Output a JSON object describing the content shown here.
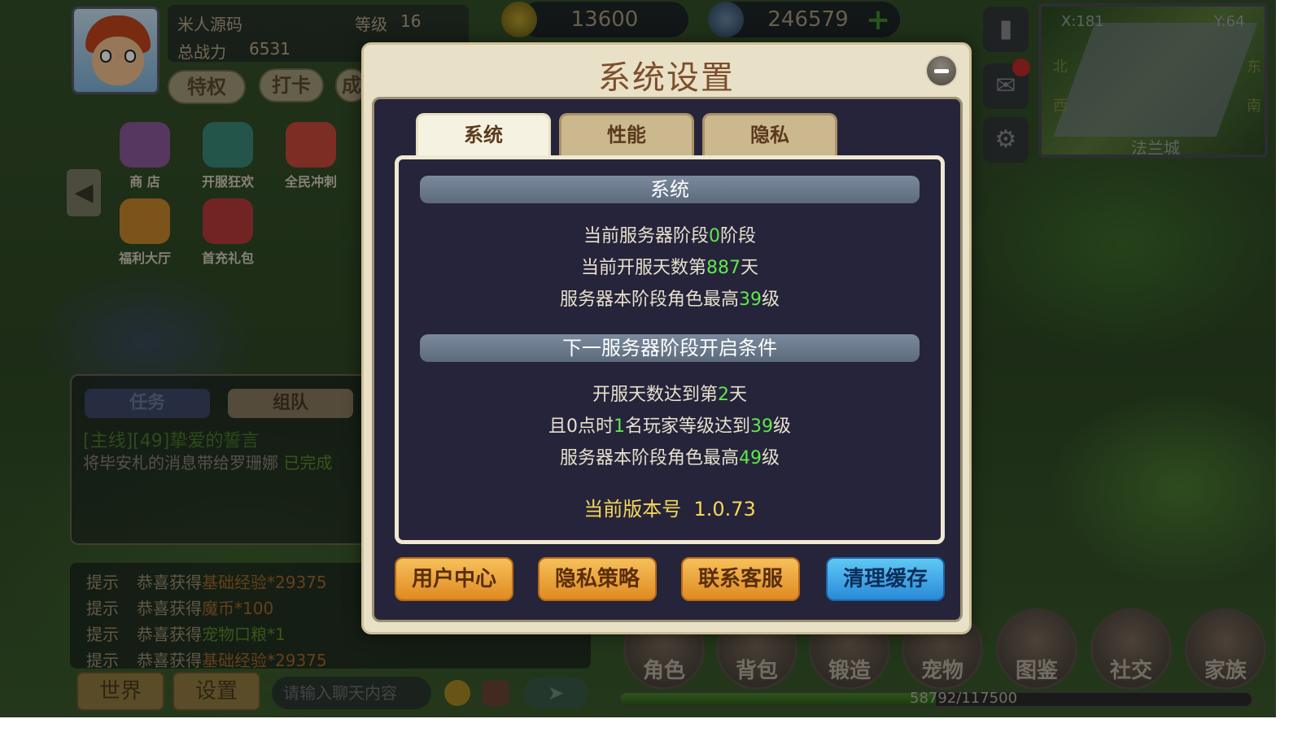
{
  "player": {
    "name": "米人源码",
    "level_label": "等级",
    "level": "16",
    "power_label": "总战力",
    "power": "6531"
  },
  "top_buttons": [
    "特权",
    "打卡",
    "成"
  ],
  "activities": [
    "商 店",
    "开服狂欢",
    "全民冲刺",
    "福利大厅",
    "首充礼包"
  ],
  "currency": {
    "gold": "13600",
    "diamond": "246579",
    "add_icon": "plus-icon"
  },
  "minimap": {
    "x_label": "X:181",
    "y_label": "Y:64",
    "north": "北",
    "east": "东",
    "west": "西",
    "south": "南",
    "city": "法兰城"
  },
  "task_panel": {
    "tabs": [
      "任务",
      "组队"
    ],
    "quest_title": "[主线][49]挚爱的誓言",
    "quest_desc": "将毕安札的消息带给罗珊娜",
    "quest_status": "已完成"
  },
  "chat": {
    "lines": [
      {
        "tag": "提示",
        "text": "恭喜获得",
        "item": "基础经验*29375",
        "color": "#a0682a"
      },
      {
        "tag": "提示",
        "text": "恭喜获得",
        "item": "魔币*100",
        "color": "#a0682a"
      },
      {
        "tag": "提示",
        "text": "恭喜获得",
        "item": "宠物口粮*1",
        "color": "#5a8a2a"
      },
      {
        "tag": "提示",
        "text": "恭喜获得",
        "item": "基础经验*29375",
        "color": "#a0682a"
      }
    ],
    "world_btn": "世界",
    "settings_btn": "设置",
    "input_placeholder": "请输入聊天内容"
  },
  "bottom_menu": [
    "角色",
    "背包",
    "锻造",
    "宠物",
    "图鉴",
    "社交",
    "家族"
  ],
  "exp": {
    "text": "58792/117500",
    "fraction": 0.5
  },
  "dialog": {
    "title": "系统设置",
    "tabs": [
      "系统",
      "性能",
      "隐私"
    ],
    "section1": "系统",
    "s1_line1": {
      "a": "当前服务器阶段",
      "v": "0",
      "b": "阶段"
    },
    "s1_line2": {
      "a": "当前开服天数第",
      "v": "887",
      "b": "天"
    },
    "s1_line3": {
      "a": "服务器本阶段角色最高",
      "v": "39",
      "b": "级"
    },
    "section2": "下一服务器阶段开启条件",
    "s2_line1": {
      "a": "开服天数达到第",
      "v": "2",
      "b": "天"
    },
    "s2_line2": {
      "a": "且0点时",
      "v": "1",
      "b": "名玩家等级达到",
      "v2": "39",
      "c": "级"
    },
    "s2_line3": {
      "a": "服务器本阶段角色最高",
      "v": "49",
      "b": "级"
    },
    "version": "当前版本号  1.0.73",
    "buttons": [
      "用户中心",
      "隐私策略",
      "联系客服",
      "清理缓存"
    ]
  },
  "colors": {
    "accent_green": "#5ee84a",
    "version_yellow": "#f6d75a",
    "orange_btn": "#e08a22",
    "blue_btn": "#2a8ad8"
  }
}
